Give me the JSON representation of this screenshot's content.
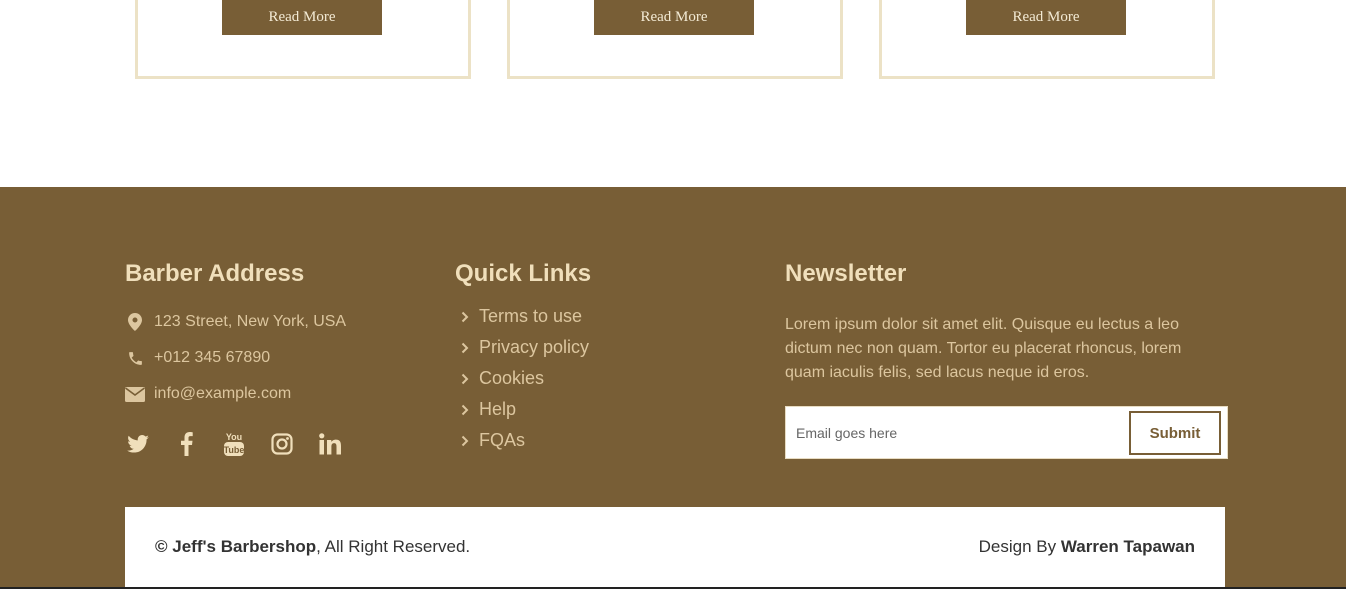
{
  "cards": [
    {
      "button_label": "Read More"
    },
    {
      "button_label": "Read More"
    },
    {
      "button_label": "Read More"
    }
  ],
  "footer": {
    "address": {
      "title": "Barber Address",
      "street": "123 Street, New York, USA",
      "phone": "+012 345 67890",
      "email": "info@example.com",
      "icons": [
        "map-marker-icon",
        "phone-icon",
        "envelope-icon"
      ],
      "social": [
        "twitter-icon",
        "facebook-icon",
        "youtube-icon",
        "instagram-icon",
        "linkedin-icon"
      ]
    },
    "quick_links": {
      "title": "Quick Links",
      "items": [
        {
          "label": "Terms to use"
        },
        {
          "label": "Privacy policy"
        },
        {
          "label": "Cookies"
        },
        {
          "label": "Help"
        },
        {
          "label": "FQAs"
        }
      ]
    },
    "newsletter": {
      "title": "Newsletter",
      "text": "Lorem ipsum dolor sit amet elit. Quisque eu lectus a leo dictum nec non quam. Tortor eu placerat rhoncus, lorem quam iaculis felis, sed lacus neque id eros.",
      "email_placeholder": "Email goes here",
      "submit_label": "Submit"
    },
    "bottom": {
      "copyright_symbol": "©",
      "company": "Jeff's Barbershop",
      "rights": ", All Right Reserved.",
      "design_prefix": "Design By ",
      "designer": "Warren Tapawan"
    }
  },
  "colors": {
    "brand": "#785e36",
    "heading": "#f0dfbb",
    "text": "#dcc69f",
    "card_border": "#ece2c6"
  }
}
